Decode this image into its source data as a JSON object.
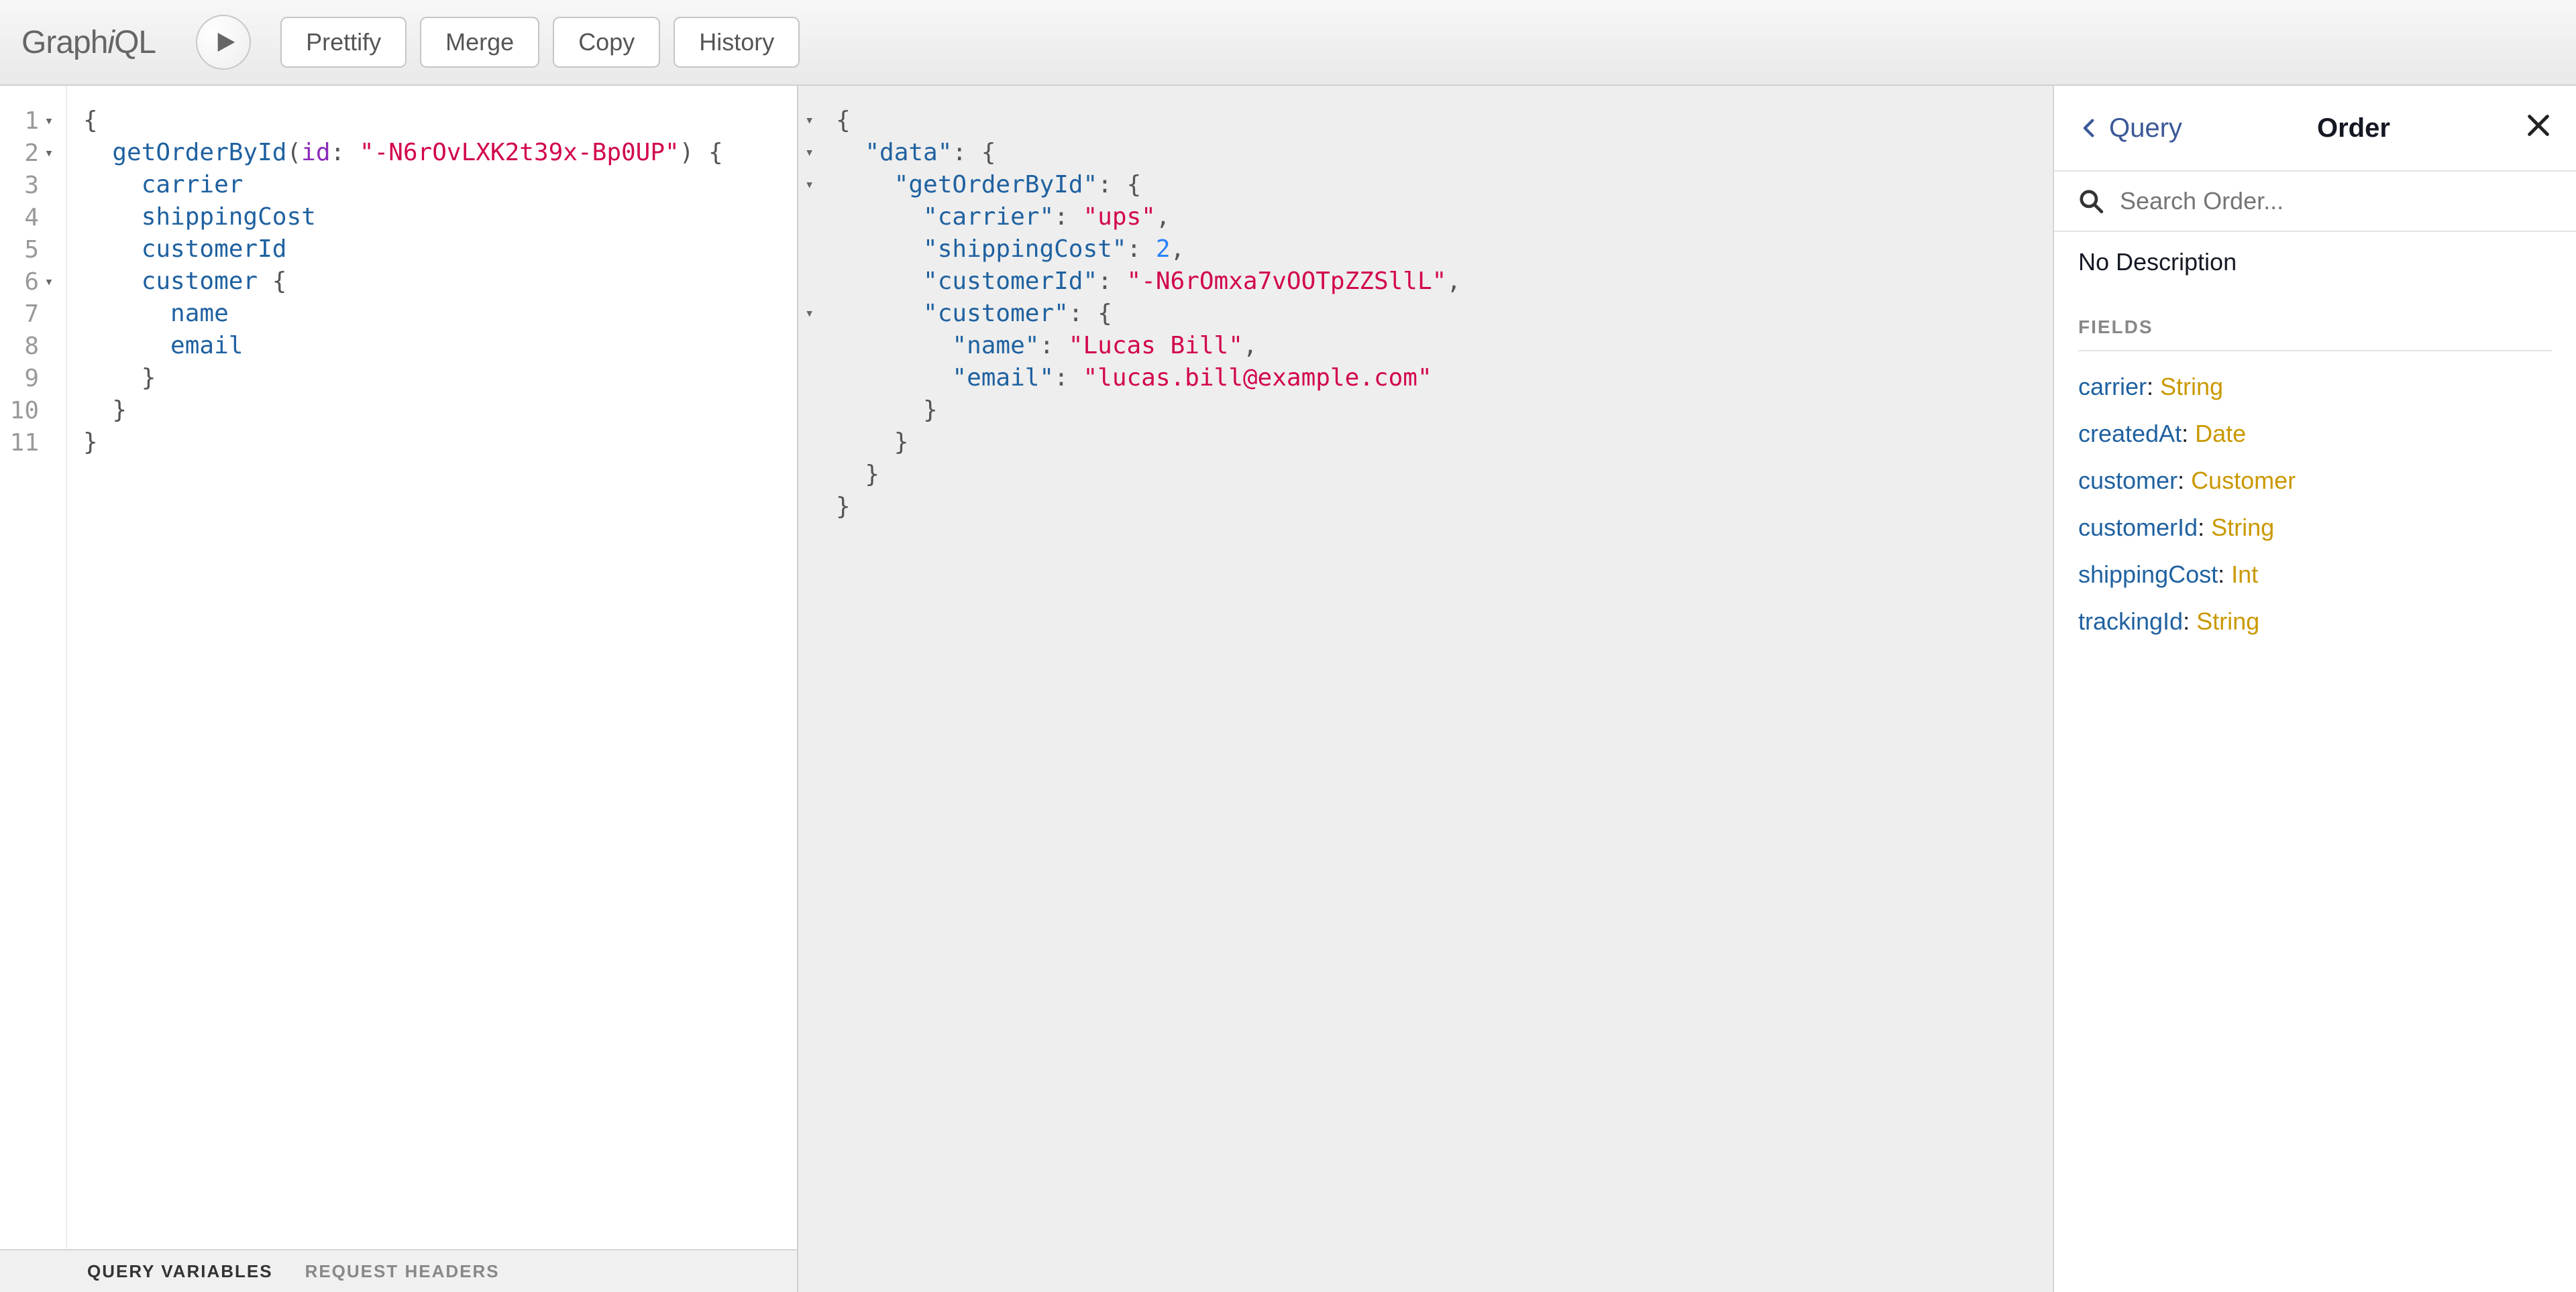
{
  "logo_html": "Graph<i>i</i>QL",
  "toolbar": {
    "prettify": "Prettify",
    "merge": "Merge",
    "copy": "Copy",
    "history": "History"
  },
  "editor_query": {
    "lines": [
      {
        "n": 1,
        "fold": true,
        "tokens": [
          [
            "brace",
            "{"
          ]
        ]
      },
      {
        "n": 2,
        "fold": true,
        "tokens": [
          [
            "plain",
            "  "
          ],
          [
            "field",
            "getOrderById"
          ],
          [
            "brace",
            "("
          ],
          [
            "attr",
            "id"
          ],
          [
            "brace",
            ": "
          ],
          [
            "str",
            "\"-N6rOvLXK2t39x-Bp0UP\""
          ],
          [
            "brace",
            ") {"
          ]
        ]
      },
      {
        "n": 3,
        "fold": false,
        "tokens": [
          [
            "plain",
            "    "
          ],
          [
            "field",
            "carrier"
          ]
        ]
      },
      {
        "n": 4,
        "fold": false,
        "tokens": [
          [
            "plain",
            "    "
          ],
          [
            "field",
            "shippingCost"
          ]
        ]
      },
      {
        "n": 5,
        "fold": false,
        "tokens": [
          [
            "plain",
            "    "
          ],
          [
            "field",
            "customerId"
          ]
        ]
      },
      {
        "n": 6,
        "fold": true,
        "tokens": [
          [
            "plain",
            "    "
          ],
          [
            "field",
            "customer"
          ],
          [
            "brace",
            " {"
          ]
        ]
      },
      {
        "n": 7,
        "fold": false,
        "tokens": [
          [
            "plain",
            "      "
          ],
          [
            "field",
            "name"
          ]
        ]
      },
      {
        "n": 8,
        "fold": false,
        "tokens": [
          [
            "plain",
            "      "
          ],
          [
            "field",
            "email"
          ]
        ]
      },
      {
        "n": 9,
        "fold": false,
        "tokens": [
          [
            "plain",
            "    "
          ],
          [
            "brace",
            "}"
          ]
        ]
      },
      {
        "n": 10,
        "fold": false,
        "tokens": [
          [
            "plain",
            "  "
          ],
          [
            "brace",
            "}"
          ]
        ]
      },
      {
        "n": 11,
        "fold": false,
        "tokens": [
          [
            "brace",
            "}"
          ]
        ]
      }
    ]
  },
  "result": {
    "fold_rows": [
      true,
      true,
      true,
      false,
      false,
      false,
      true,
      false,
      false,
      false,
      false,
      false
    ],
    "lines": [
      [
        [
          "brace",
          "{"
        ]
      ],
      [
        [
          "plain",
          "  "
        ],
        [
          "key",
          "\"data\""
        ],
        [
          "brace",
          ": {"
        ]
      ],
      [
        [
          "plain",
          "    "
        ],
        [
          "key",
          "\"getOrderById\""
        ],
        [
          "brace",
          ": {"
        ]
      ],
      [
        [
          "plain",
          "      "
        ],
        [
          "key",
          "\"carrier\""
        ],
        [
          "brace",
          ": "
        ],
        [
          "str",
          "\"ups\""
        ],
        [
          "brace",
          ","
        ]
      ],
      [
        [
          "plain",
          "      "
        ],
        [
          "key",
          "\"shippingCost\""
        ],
        [
          "brace",
          ": "
        ],
        [
          "num",
          "2"
        ],
        [
          "brace",
          ","
        ]
      ],
      [
        [
          "plain",
          "      "
        ],
        [
          "key",
          "\"customerId\""
        ],
        [
          "brace",
          ": "
        ],
        [
          "str",
          "\"-N6rOmxa7vOOTpZZSllL\""
        ],
        [
          "brace",
          ","
        ]
      ],
      [
        [
          "plain",
          "      "
        ],
        [
          "key",
          "\"customer\""
        ],
        [
          "brace",
          ": {"
        ]
      ],
      [
        [
          "plain",
          "        "
        ],
        [
          "key",
          "\"name\""
        ],
        [
          "brace",
          ": "
        ],
        [
          "str",
          "\"Lucas Bill\""
        ],
        [
          "brace",
          ","
        ]
      ],
      [
        [
          "plain",
          "        "
        ],
        [
          "key",
          "\"email\""
        ],
        [
          "brace",
          ": "
        ],
        [
          "str",
          "\"lucas.bill@example.com\""
        ]
      ],
      [
        [
          "plain",
          "      "
        ],
        [
          "brace",
          "}"
        ]
      ],
      [
        [
          "plain",
          "    "
        ],
        [
          "brace",
          "}"
        ]
      ],
      [
        [
          "plain",
          "  "
        ],
        [
          "brace",
          "}"
        ]
      ],
      [
        [
          "brace",
          "}"
        ]
      ]
    ]
  },
  "bottom_tabs": {
    "variables": "Query Variables",
    "headers": "Request Headers"
  },
  "docs": {
    "back_label": "Query",
    "title": "Order",
    "search_placeholder": "Search Order...",
    "description": "No Description",
    "section_label": "Fields",
    "fields": [
      {
        "name": "carrier",
        "type": "String"
      },
      {
        "name": "createdAt",
        "type": "Date"
      },
      {
        "name": "customer",
        "type": "Customer"
      },
      {
        "name": "customerId",
        "type": "String"
      },
      {
        "name": "shippingCost",
        "type": "Int"
      },
      {
        "name": "trackingId",
        "type": "String"
      }
    ]
  }
}
